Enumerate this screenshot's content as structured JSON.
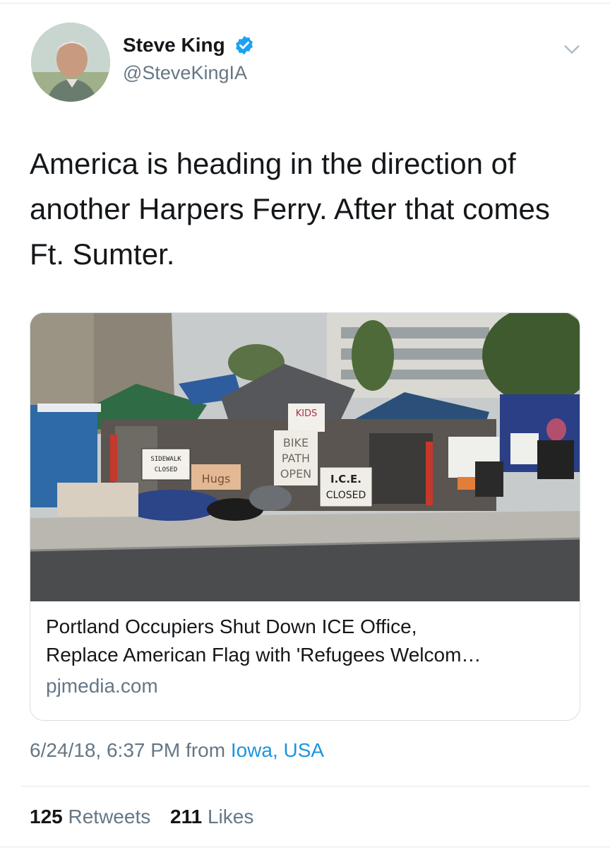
{
  "author": {
    "display_name": "Steve King",
    "handle": "@SteveKingIA",
    "verified": true
  },
  "tweet": {
    "text": "America is heading in the direction of another Harpers Ferry. After that comes Ft. Sumter."
  },
  "card": {
    "title": "Portland Occupiers Shut Down ICE Office,\nReplace American Flag with 'Refugees Welcom…",
    "domain": "pjmedia.com",
    "image_signs": {
      "sidewalk_line1": "SIDEWALK",
      "sidewalk_line2": "CLOSED",
      "kids": "KIDS",
      "bike_line1": "BIKE",
      "bike_line2": "PATH",
      "bike_line3": "OPEN",
      "ice_line1": "I.C.E.",
      "ice_line2": "CLOSED",
      "hugs": "Hugs"
    }
  },
  "meta": {
    "timestamp": "6/24/18, 6:37 PM",
    "from_label": "from",
    "location": "Iowa, USA"
  },
  "stats": {
    "retweets_count": "125",
    "retweets_label": "Retweets",
    "likes_count": "211",
    "likes_label": "Likes"
  },
  "colors": {
    "link": "#1b95e0",
    "secondary_text": "#657786",
    "verified_badge": "#1da1f2"
  },
  "icons": [
    "verified-badge-icon",
    "chevron-down-icon"
  ]
}
